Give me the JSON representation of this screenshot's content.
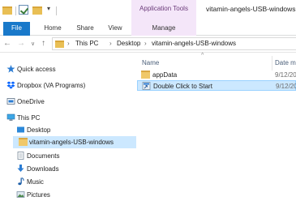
{
  "titlebar": {
    "context_tab_label": "Application Tools",
    "window_title": "vitamin-angels-USB-windows",
    "qat_dropdown": "▾"
  },
  "ribbon": {
    "tabs": [
      "File",
      "Home",
      "Share",
      "View",
      "Manage"
    ]
  },
  "address": {
    "nav_back": "←",
    "nav_forward": "→",
    "nav_recent": "∨",
    "nav_up": "↑",
    "separator": "›",
    "crumbs": [
      "This PC",
      "Desktop",
      "vitamin-angels-USB-windows"
    ]
  },
  "nav_pane": {
    "items": [
      {
        "label": "Quick access",
        "icon": "star-icon"
      },
      {
        "label": "Dropbox (VA Programs)",
        "icon": "dropbox-icon"
      },
      {
        "label": "OneDrive",
        "icon": "onedrive-icon"
      },
      {
        "label": "This PC",
        "icon": "computer-icon"
      },
      {
        "label": "Desktop",
        "icon": "desktop-icon"
      },
      {
        "label": "vitamin-angels-USB-windows",
        "icon": "folder-icon"
      },
      {
        "label": "Documents",
        "icon": "documents-icon"
      },
      {
        "label": "Downloads",
        "icon": "downloads-icon"
      },
      {
        "label": "Music",
        "icon": "music-icon"
      },
      {
        "label": "Pictures",
        "icon": "pictures-icon"
      }
    ]
  },
  "file_list": {
    "sort_indicator": "^",
    "columns": [
      "Name",
      "Date m"
    ],
    "rows": [
      {
        "name": "appData",
        "date": "9/12/20",
        "icon": "folder-icon"
      },
      {
        "name": "Double Click to Start",
        "date": "9/12/20",
        "icon": "shortcut-icon",
        "selected": true
      }
    ]
  },
  "colors": {
    "file_tab": "#1979ca",
    "context_tab": "#f4e6f9",
    "selection": "#cce8ff",
    "folder": "#f0c869"
  }
}
